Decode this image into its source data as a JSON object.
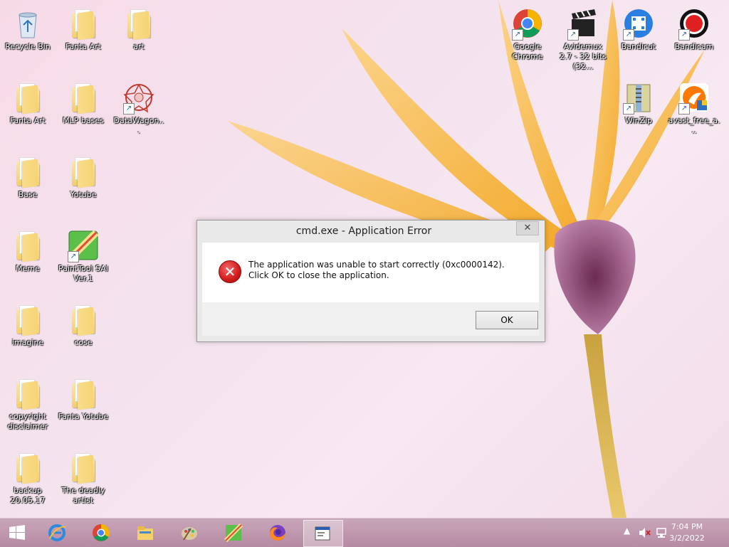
{
  "desktop": {
    "icons": [
      {
        "label": "Recycle Bin",
        "type": "recycle",
        "shortcut": false
      },
      {
        "label": "Fanta Art",
        "type": "folder",
        "shortcut": false
      },
      {
        "label": "art",
        "type": "folder",
        "shortcut": false
      },
      {
        "label": "Fanta Art",
        "type": "folder",
        "shortcut": false
      },
      {
        "label": "MLP bases",
        "type": "folder",
        "shortcut": false
      },
      {
        "label": "DataWagon...",
        "type": "app-datawagon",
        "shortcut": true
      },
      {
        "label": "Base",
        "type": "folder",
        "shortcut": false
      },
      {
        "label": "Yotube",
        "type": "folder",
        "shortcut": false
      },
      {
        "label": "Meme",
        "type": "folder",
        "shortcut": false
      },
      {
        "label": "PaintTool SAI Ver.1",
        "type": "app-paintsai",
        "shortcut": true
      },
      {
        "label": "imagine",
        "type": "folder",
        "shortcut": false
      },
      {
        "label": "cose",
        "type": "folder",
        "shortcut": false
      },
      {
        "label": "copyright disclaimer",
        "type": "folder",
        "shortcut": false
      },
      {
        "label": "Fanta Yotube",
        "type": "folder",
        "shortcut": false
      },
      {
        "label": "backup 20.05.17",
        "type": "folder",
        "shortcut": false
      },
      {
        "label": "The deadly artist",
        "type": "folder",
        "shortcut": false
      },
      {
        "label": "Google Chrome",
        "type": "app-chrome",
        "shortcut": true
      },
      {
        "label": "Avidemux 2.7 - 32 bits (32...",
        "type": "app-avidemux",
        "shortcut": true
      },
      {
        "label": "Bandicut",
        "type": "app-bandicut",
        "shortcut": true
      },
      {
        "label": "Bandicam",
        "type": "app-bandicam",
        "shortcut": true
      },
      {
        "label": "WinZip",
        "type": "app-winzip",
        "shortcut": true
      },
      {
        "label": "avast_free_a...",
        "type": "app-avast",
        "shortcut": true
      }
    ]
  },
  "dialog": {
    "title": "cmd.exe - Application Error",
    "close_label": "✕",
    "icon": "error-icon",
    "message": "The application was unable to start correctly (0xc0000142). Click OK to close the application.",
    "ok_label": "OK"
  },
  "taskbar": {
    "buttons": [
      {
        "name": "start-button",
        "icon": "windows-logo-icon"
      },
      {
        "name": "internet-explorer",
        "icon": "internet-explorer-icon"
      },
      {
        "name": "google-chrome",
        "icon": "chrome-icon"
      },
      {
        "name": "file-explorer",
        "icon": "folder-icon"
      },
      {
        "name": "paint-palette",
        "icon": "palette-icon"
      },
      {
        "name": "painttool-sai",
        "icon": "painttool-sai-icon"
      },
      {
        "name": "firefox",
        "icon": "firefox-icon"
      },
      {
        "name": "cmd-window",
        "icon": "window-icon",
        "active": true
      }
    ],
    "tray": {
      "show_hidden": "▲",
      "volume_icon": "speaker-muted-icon",
      "network_icon": "network-icon"
    },
    "clock": {
      "time": "7:04 PM",
      "date": "3/2/2022"
    }
  },
  "colors": {
    "error_red": "#d11b1b",
    "taskbar": "#b58aa3",
    "folder": "#f2cf6c"
  }
}
